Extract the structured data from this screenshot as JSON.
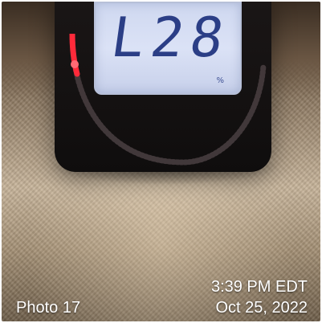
{
  "photo": {
    "label": "Photo 17",
    "time": "3:39 PM EDT",
    "date": "Oct 25, 2022"
  },
  "device": {
    "display_reading": "L28",
    "display_unit_text": "%"
  },
  "colors": {
    "lcd_background": "#d3dbf2",
    "lcd_digits": "#2b3e86",
    "gauge_red": "#ff2a3a",
    "device_body": "#141111"
  },
  "icons": {
    "gauge": "arc-led-gauge"
  }
}
